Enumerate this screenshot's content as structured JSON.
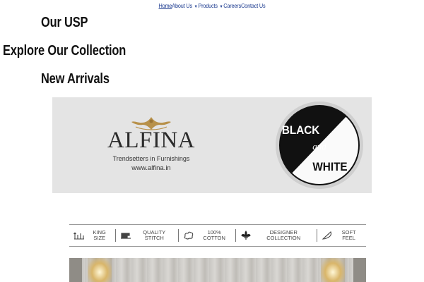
{
  "nav": {
    "items": [
      {
        "label": "Home",
        "active": true,
        "dropdown": false
      },
      {
        "label": "About Us",
        "active": false,
        "dropdown": true
      },
      {
        "label": "Products",
        "active": false,
        "dropdown": true
      },
      {
        "label": "Careers",
        "active": false,
        "dropdown": false
      },
      {
        "label": "Contact Us",
        "active": false,
        "dropdown": false
      }
    ]
  },
  "sections": {
    "usp": "Our USP",
    "explore": "Explore Our Collection",
    "new_arrivals": "New Arrivals"
  },
  "banner": {
    "brand_name": "ALFINA",
    "tagline": "Trendsetters in Furnishings",
    "url": "www.alfina.in",
    "badge": {
      "top": "BLACK",
      "middle": "and",
      "bottom": "WHITE"
    },
    "features": [
      {
        "icon": "ruler-icon",
        "label": "KING SIZE"
      },
      {
        "icon": "sewing-machine-icon",
        "label": "QUALITY STITCH"
      },
      {
        "icon": "cotton-icon",
        "label": "100% COTTON"
      },
      {
        "icon": "fleur-de-lis-icon",
        "label": "DESIGNER COLLECTION"
      },
      {
        "icon": "feather-icon",
        "label": "SOFT FEEL"
      }
    ]
  },
  "colors": {
    "nav_link": "#1b3a8f",
    "heading": "#111111",
    "banner_band": "#e4e4e4",
    "crest_gold": "#b8914a"
  }
}
